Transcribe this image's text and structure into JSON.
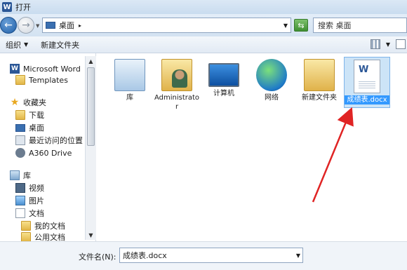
{
  "window": {
    "title": "打开",
    "app_icon": "word-icon"
  },
  "address": {
    "path": "桌面",
    "search_placeholder": "搜索 桌面"
  },
  "toolbar": {
    "organize": "组织",
    "new_folder": "新建文件夹"
  },
  "sidebar": {
    "items": [
      {
        "label": "Microsoft Word",
        "icon": "word-icon"
      },
      {
        "label": "Templates",
        "icon": "folder-icon"
      },
      {
        "label": "收藏夹",
        "icon": "star-icon"
      },
      {
        "label": "下载",
        "icon": "folder-icon"
      },
      {
        "label": "桌面",
        "icon": "desktop-icon"
      },
      {
        "label": "最近访问的位置",
        "icon": "recent-places-icon"
      },
      {
        "label": "A360 Drive",
        "icon": "a360-icon"
      },
      {
        "label": "库",
        "icon": "library-icon"
      },
      {
        "label": "视频",
        "icon": "video-icon"
      },
      {
        "label": "图片",
        "icon": "picture-icon"
      },
      {
        "label": "文档",
        "icon": "document-icon"
      },
      {
        "label": "我的文档",
        "icon": "folder-icon"
      },
      {
        "label": "公用文档",
        "icon": "folder-icon"
      }
    ]
  },
  "files": [
    {
      "name": "库",
      "icon": "library-icon"
    },
    {
      "name": "Administrator",
      "icon": "user-folder-icon"
    },
    {
      "name": "计算机",
      "icon": "computer-icon"
    },
    {
      "name": "网络",
      "icon": "network-icon"
    },
    {
      "name": "新建文件夹",
      "icon": "folder-icon"
    },
    {
      "name": "成绩表.docx",
      "icon": "word-document-icon",
      "selected": true
    }
  ],
  "bottom": {
    "filename_label": "文件名(N):",
    "filename_value": "成绩表.docx"
  },
  "colors": {
    "arrow": "#e02424",
    "selection": "#cce4f7",
    "selection_text_bg": "#3399ff"
  }
}
